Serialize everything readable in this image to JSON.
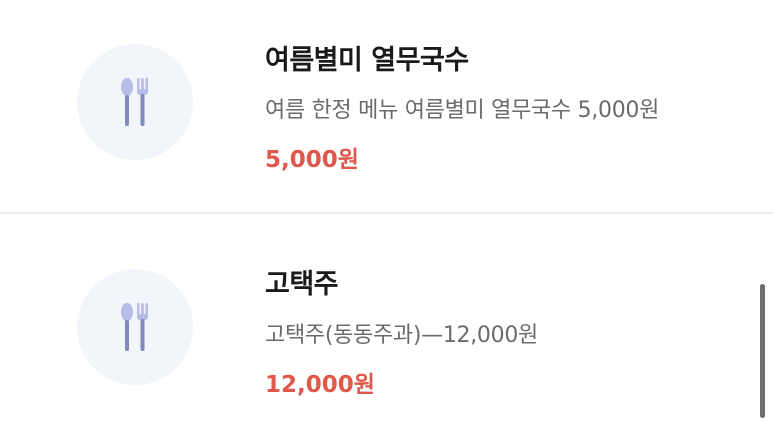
{
  "menu": {
    "items": [
      {
        "name": "여름별미 열무국수",
        "description": "여름 한정 메뉴 여름별미 열무국수 5,000원",
        "price": "5,000원",
        "icon": "fork-spoon-icon"
      },
      {
        "name": "고택주",
        "description": "고택주(동동주과)—12,000원",
        "price": "12,000원",
        "icon": "fork-spoon-icon"
      }
    ]
  },
  "colors": {
    "price": "#e0574b",
    "thumb_bg": "#f2f5fa",
    "icon_color": "#8a97c9"
  }
}
